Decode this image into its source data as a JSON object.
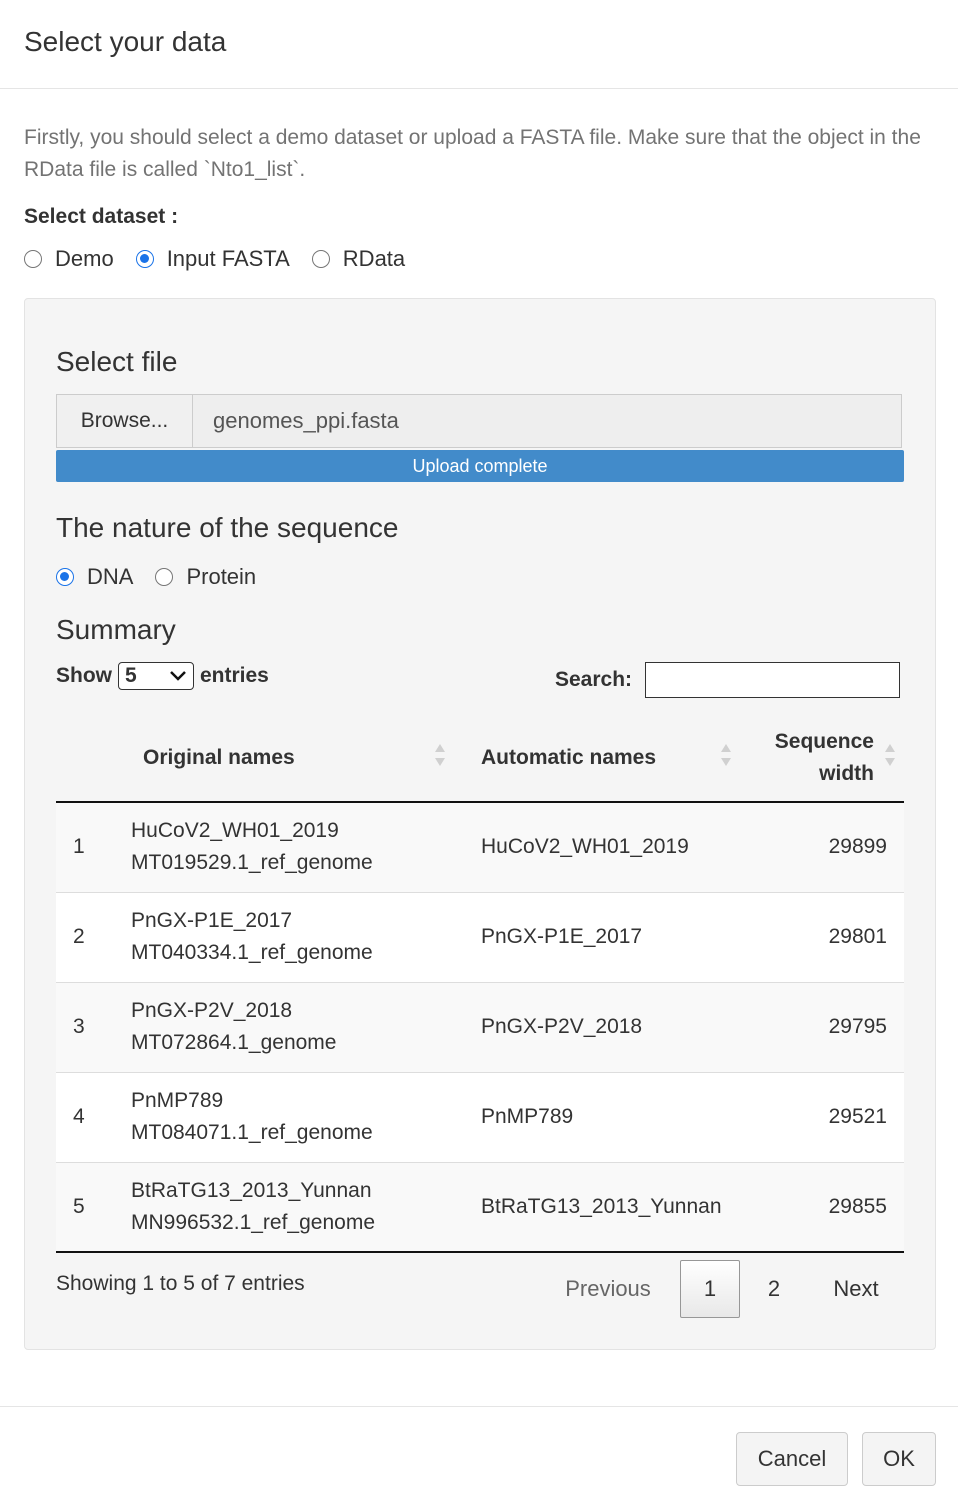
{
  "modal": {
    "title": "Select your data",
    "intro": "Firstly, you should select a demo dataset or upload a FASTA file. Make sure that the object in the RData file is called `Nto1_list`."
  },
  "dataset": {
    "label": "Select dataset :",
    "options": [
      {
        "label": "Demo",
        "checked": false
      },
      {
        "label": "Input FASTA",
        "checked": true
      },
      {
        "label": "RData",
        "checked": false
      }
    ]
  },
  "file": {
    "heading": "Select file",
    "browse_label": "Browse...",
    "file_name": "genomes_ppi.fasta",
    "progress_label": "Upload complete",
    "progress": 1.0
  },
  "nature": {
    "heading": "The nature of the sequence",
    "options": [
      {
        "label": "DNA",
        "checked": true
      },
      {
        "label": "Protein",
        "checked": false
      }
    ]
  },
  "summary": {
    "heading": "Summary",
    "show_label": "Show",
    "entries_value": "5",
    "entries_label": "entries",
    "search_label": "Search:",
    "search_value": "",
    "columns": [
      "",
      "Original names",
      "Automatic names",
      "Sequence width"
    ],
    "rows": [
      {
        "idx": "1",
        "orig_1": "HuCoV2_WH01_2019",
        "orig_2": "MT019529.1_ref_genome",
        "auto": "HuCoV2_WH01_2019",
        "width": "29899"
      },
      {
        "idx": "2",
        "orig_1": "PnGX-P1E_2017",
        "orig_2": "MT040334.1_ref_genome",
        "auto": "PnGX-P1E_2017",
        "width": "29801"
      },
      {
        "idx": "3",
        "orig_1": "PnGX-P2V_2018",
        "orig_2": "MT072864.1_genome",
        "auto": "PnGX-P2V_2018",
        "width": "29795"
      },
      {
        "idx": "4",
        "orig_1": "PnMP789",
        "orig_2": "MT084071.1_ref_genome",
        "auto": "PnMP789",
        "width": "29521"
      },
      {
        "idx": "5",
        "orig_1": "BtRaTG13_2013_Yunnan",
        "orig_2": "MN996532.1_ref_genome",
        "auto": "BtRaTG13_2013_Yunnan",
        "width": "29855"
      }
    ],
    "info": "Showing 1 to 5 of 7 entries",
    "pagination": {
      "previous": "Previous",
      "pages": [
        "1",
        "2"
      ],
      "current": "1",
      "next": "Next"
    }
  },
  "footer": {
    "cancel_label": "Cancel",
    "ok_label": "OK"
  },
  "colors": {
    "progress": "#428bca",
    "radio_checked": "#1a73e8"
  }
}
